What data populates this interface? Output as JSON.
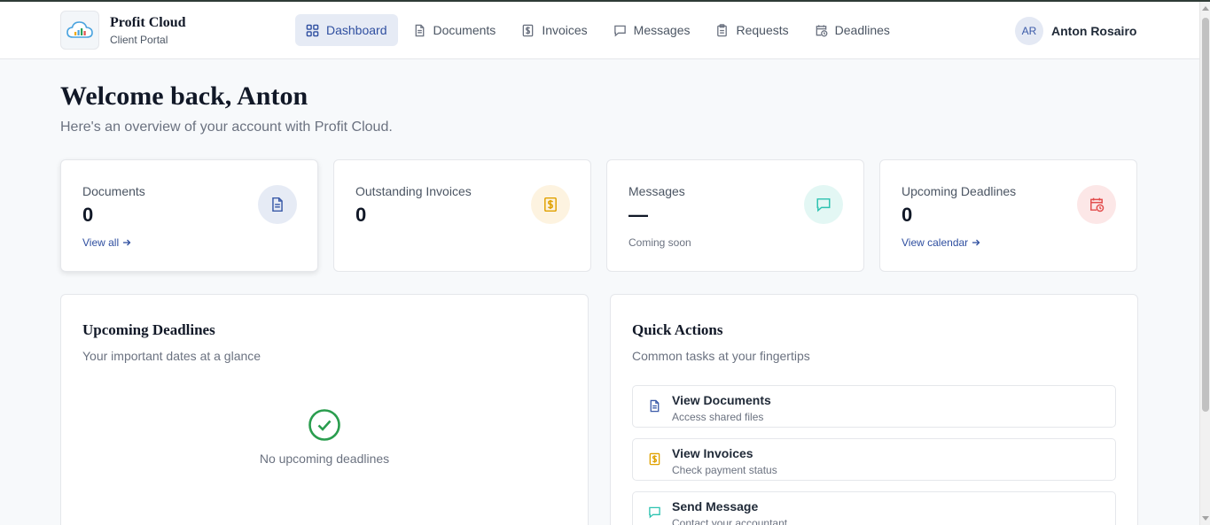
{
  "brand": {
    "name": "Profit Cloud",
    "subtitle": "Client Portal"
  },
  "nav": [
    {
      "label": "Dashboard",
      "icon": "grid-icon",
      "active": true
    },
    {
      "label": "Documents",
      "icon": "document-icon"
    },
    {
      "label": "Invoices",
      "icon": "invoice-dollar-icon"
    },
    {
      "label": "Messages",
      "icon": "message-icon"
    },
    {
      "label": "Requests",
      "icon": "clipboard-icon"
    },
    {
      "label": "Deadlines",
      "icon": "calendar-clock-icon"
    }
  ],
  "user": {
    "initials": "AR",
    "name": "Anton Rosairo"
  },
  "welcome": {
    "title": "Welcome back, Anton",
    "subtitle": "Here's an overview of your account with Profit Cloud."
  },
  "stats": [
    {
      "label": "Documents",
      "value": "0",
      "link": "View all",
      "icon": "document-icon",
      "color": "#3a5aa8"
    },
    {
      "label": "Outstanding Invoices",
      "value": "0",
      "icon": "invoice-dollar-icon",
      "color": "#e0a100"
    },
    {
      "label": "Messages",
      "value": "—",
      "note": "Coming soon",
      "icon": "message-icon",
      "color": "#2cc2b0"
    },
    {
      "label": "Upcoming Deadlines",
      "value": "0",
      "link": "View calendar",
      "icon": "calendar-clock-icon",
      "color": "#e24b4b"
    }
  ],
  "deadlines_panel": {
    "title": "Upcoming Deadlines",
    "subtitle": "Your important dates at a glance",
    "empty_text": "No upcoming deadlines",
    "empty_icon": "check-circle-icon"
  },
  "quick_actions": {
    "title": "Quick Actions",
    "subtitle": "Common tasks at your fingertips",
    "items": [
      {
        "title": "View Documents",
        "subtitle": "Access shared files",
        "icon": "document-icon"
      },
      {
        "title": "View Invoices",
        "subtitle": "Check payment status",
        "icon": "invoice-dollar-icon"
      },
      {
        "title": "Send Message",
        "subtitle": "Contact your accountant",
        "icon": "message-icon"
      }
    ]
  }
}
